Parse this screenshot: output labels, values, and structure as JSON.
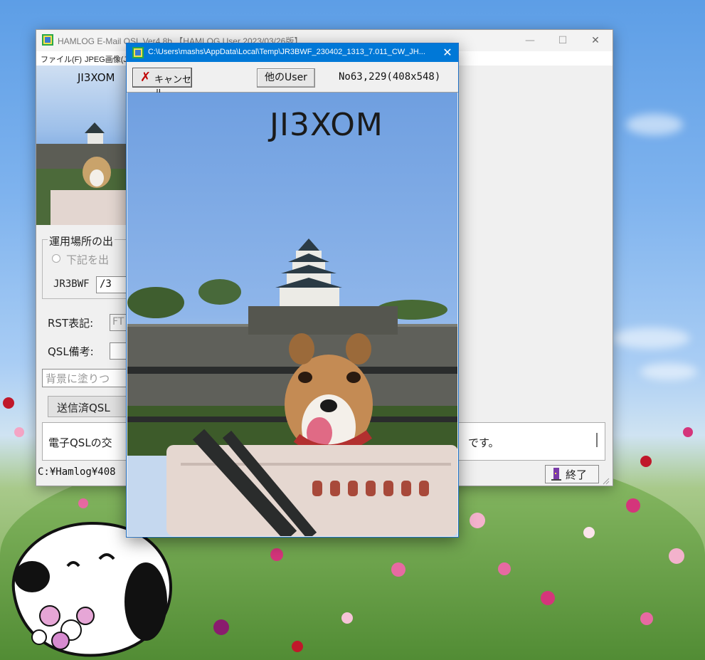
{
  "main_window": {
    "title": "HAMLOG E-Mail QSL Ver4.8b 【HAMLOG User 2023/03/26版】",
    "menu": [
      "ファイル(F)",
      "JPEG画像(J)"
    ],
    "window_controls": {
      "minimize": "—",
      "maximize": "☐",
      "close": "✕"
    },
    "photo_callsign": "JI3XOM",
    "location_group_label": "運用場所の出",
    "radio_label": "下記を出",
    "callsign_label": "JR3BWF",
    "callsign_suffix": "/3",
    "rst_label": "RST表記:",
    "rst_value": "FT",
    "qsl_note_label": "QSL備考:",
    "background_field": "背景に塗りつ",
    "sent_qsl_button": "送信済QSL",
    "memo_text_left": "電子QSLの交",
    "memo_text_right": "です。",
    "status_path": "C:¥Hamlog¥408",
    "exit_button": "終了"
  },
  "popup_window": {
    "title": "C:\\Users\\mashs\\AppData\\Local\\Temp\\JR3BWF_230402_1313_7.011_CW_JH...",
    "close": "✕",
    "cancel_button": "キャンセル",
    "other_user_button": "他のUser",
    "image_info": "No63,229(408x548)",
    "qsl_callsign": "JI3XOM"
  },
  "colors": {
    "popup_titlebar": "#0078d7",
    "cancel_x": "#c00000"
  }
}
